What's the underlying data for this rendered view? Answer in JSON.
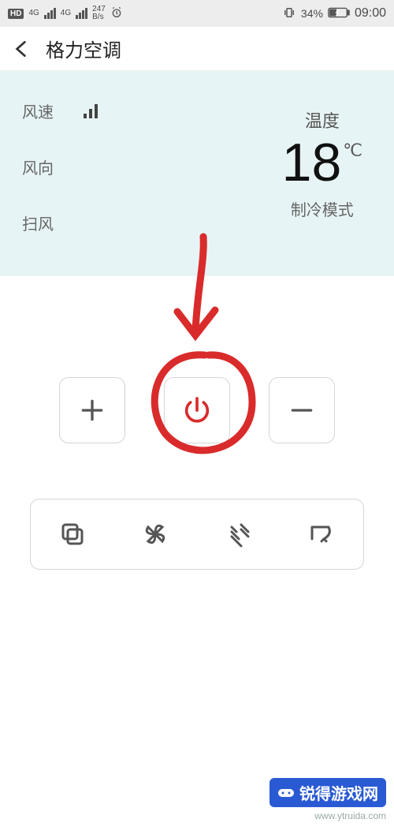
{
  "status": {
    "hd": "HD",
    "net1": "4G",
    "net2": "4G",
    "speed_val": "247",
    "speed_unit": "B/s",
    "battery_pct": "34%",
    "time": "09:00"
  },
  "appbar": {
    "title": "格力空调"
  },
  "panel": {
    "fan_speed_label": "风速",
    "fan_dir_label": "风向",
    "swing_label": "扫风",
    "temp_label": "温度",
    "temp_value": "18",
    "temp_unit": "℃",
    "mode_text": "制冷模式"
  },
  "buttons": {
    "plus": "plus-icon",
    "power": "power-icon",
    "minus": "minus-icon"
  },
  "modes": {
    "m1": "mode-icon",
    "m2": "fan-icon",
    "m3": "airflow-icon",
    "m4": "swing-icon"
  },
  "watermark": {
    "brand": "锐得游戏网",
    "url": "www.ytruida.com"
  },
  "colors": {
    "accent_red": "#d92b2b",
    "panel_bg": "#e7f4f5"
  }
}
